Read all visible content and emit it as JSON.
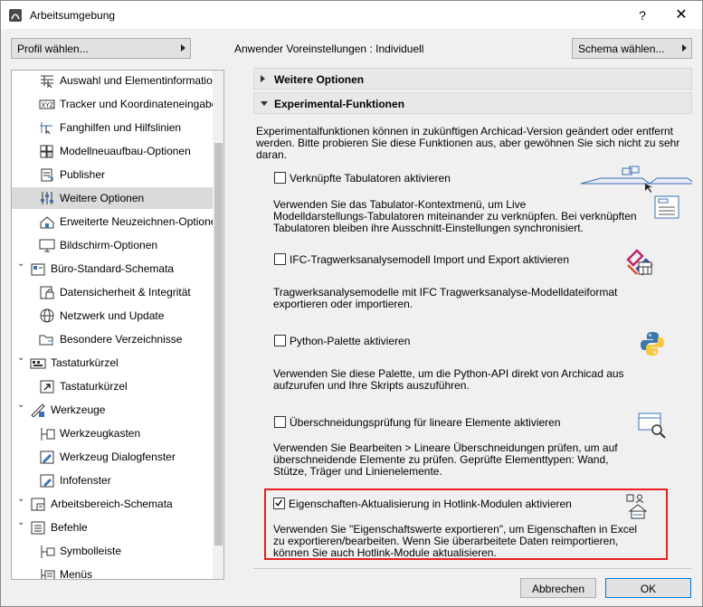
{
  "window": {
    "title": "Arbeitsumgebung",
    "help": "?",
    "close": "✕"
  },
  "toolbar": {
    "profile_button": "Profil wählen...",
    "preset_label": "Anwender Voreinstellungen : Individuell",
    "schema_button": "Schema wählen..."
  },
  "tree": {
    "items": [
      {
        "label": "Auswahl und Elementinformation",
        "icon": "selection-icon",
        "level": 2
      },
      {
        "label": "Tracker und Koordinateneingabe",
        "icon": "xyz-icon",
        "level": 2
      },
      {
        "label": "Fanghilfen und Hilfslinien",
        "icon": "guides-icon",
        "level": 2
      },
      {
        "label": "Modellneuaufbau-Optionen",
        "icon": "rebuild-icon",
        "level": 2
      },
      {
        "label": "Publisher",
        "icon": "publisher-icon",
        "level": 2
      },
      {
        "label": "Weitere Optionen",
        "icon": "sliders-icon",
        "level": 2,
        "selected": true
      },
      {
        "label": "Erweiterte Neuzeichnen-Optionen",
        "icon": "redraw-icon",
        "level": 2
      },
      {
        "label": "Bildschirm-Optionen",
        "icon": "screen-icon",
        "level": 2
      },
      {
        "label": "Büro-Standard-Schemata",
        "icon": "office-icon",
        "level": 1,
        "expanded": true
      },
      {
        "label": "Datensicherheit & Integrität",
        "icon": "security-icon",
        "level": 2
      },
      {
        "label": "Netzwerk und Update",
        "icon": "globe-icon",
        "level": 2
      },
      {
        "label": "Besondere Verzeichnisse",
        "icon": "folder-icon",
        "level": 2
      },
      {
        "label": "Tastaturkürzel",
        "icon": "keyboard-icon",
        "level": 1,
        "expanded": true
      },
      {
        "label": "Tastaturkürzel",
        "icon": "shortcut-icon",
        "level": 2
      },
      {
        "label": "Werkzeuge",
        "icon": "tools-icon",
        "level": 1,
        "expanded": true
      },
      {
        "label": "Werkzeugkasten",
        "icon": "toolbox-icon",
        "level": 2
      },
      {
        "label": "Werkzeug Dialogfenster",
        "icon": "tool-dialog-icon",
        "level": 2
      },
      {
        "label": "Infofenster",
        "icon": "info-icon",
        "level": 2
      },
      {
        "label": "Arbeitsbereich-Schemata",
        "icon": "workspace-icon",
        "level": 1
      },
      {
        "label": "Befehle",
        "icon": "commands-icon",
        "level": 1,
        "expanded": true
      },
      {
        "label": "Symbolleiste",
        "icon": "toolbar-icon",
        "level": 2
      },
      {
        "label": "Menüs",
        "icon": "menu-icon",
        "level": 2
      }
    ]
  },
  "content": {
    "section_more": "Weitere Optionen",
    "section_experimental": "Experimental-Funktionen",
    "intro": [
      "Experimentalfunktionen können in zukünftigen Archicad-Version geändert oder entfernt",
      "werden. Bitte probieren Sie diese Funktionen aus, aber gewöhnen Sie sich nicht zu sehr",
      "daran."
    ],
    "options": [
      {
        "label": "Verknüpfte Tabulatoren aktivieren",
        "checked": false,
        "icon": "linked-tabs-icon",
        "desc": [
          "Verwenden Sie das Tabulator-Kontextmenü, um Live",
          "Modelldarstellungs-Tabulatoren miteinander zu verknüpfen. Bei verknüpften",
          "Tabulatoren bleiben ihre Ausschnitt-Einstellungen synchronisiert."
        ]
      },
      {
        "label": "IFC-Tragwerksanalysemodell Import und Export aktivieren",
        "checked": false,
        "icon": "ifc-icon",
        "desc": [
          "Tragwerksanalysemodelle mit IFC Tragwerksanalyse-Modelldateiformat",
          "exportieren oder importieren."
        ]
      },
      {
        "label": "Python-Palette aktivieren",
        "checked": false,
        "icon": "python-icon",
        "desc": [
          "Verwenden Sie diese Palette, um die Python-API direkt von Archicad aus",
          "aufzurufen und Ihre Skripts auszuführen."
        ]
      },
      {
        "label": "Überschneidungsprüfung für lineare Elemente aktivieren",
        "checked": false,
        "icon": "intersection-icon",
        "desc": [
          "Verwenden Sie Bearbeiten > Lineare Überschneidungen prüfen, um auf",
          "überschneidende Elemente zu prüfen. Geprüfte Elementtypen: Wand,",
          "Stütze, Träger und Linienelemente."
        ]
      },
      {
        "label": "Eigenschaften-Aktualisierung in Hotlink-Modulen aktivieren",
        "checked": true,
        "icon": "hotlink-icon",
        "desc": [
          "Verwenden Sie \"Eigenschaftswerte exportieren\", um Eigenschaften in Excel",
          "zu exportieren/bearbeiten. Wenn Sie überarbeitete Daten reimportieren,",
          "können Sie auch Hotlink-Module aktualisieren."
        ]
      }
    ]
  },
  "footer": {
    "cancel": "Abbrechen",
    "ok": "OK"
  },
  "colors": {
    "highlight_box": "#e81f1f",
    "selected_row": "#dadada",
    "python_blue": "#3c78aa",
    "python_yellow": "#f7c93e",
    "ifc_accent": "#c0206a"
  }
}
